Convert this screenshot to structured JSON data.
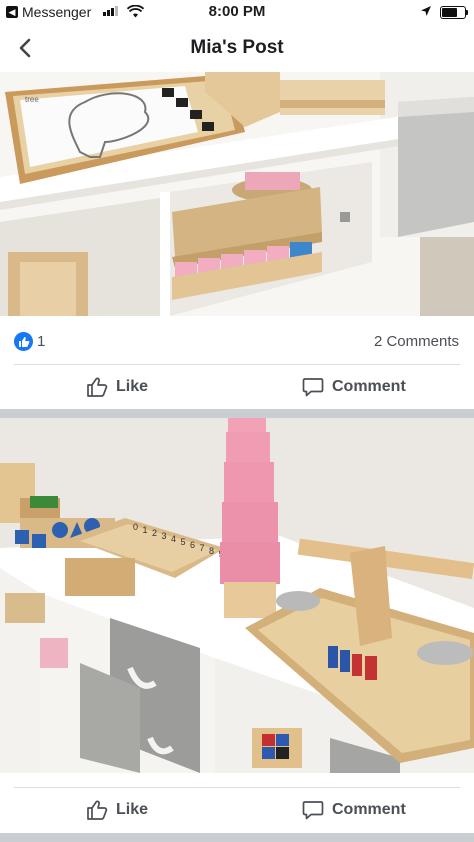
{
  "status_bar": {
    "back_app": "Messenger",
    "time": "8:00 PM",
    "battery_level": 0.75
  },
  "nav": {
    "title": "Mia's Post"
  },
  "post": {
    "reaction_count": "1",
    "comments_label": "2 Comments",
    "like_label": "Like",
    "comment_label": "Comment"
  },
  "photo1": {
    "card_label": "tree"
  },
  "photo2": {
    "numbers": [
      "0",
      "1",
      "2",
      "3",
      "4",
      "5",
      "6",
      "7",
      "8",
      "9"
    ]
  },
  "second_post": {
    "like_label": "Like",
    "comment_label": "Comment"
  },
  "colors": {
    "facebook_blue": "#1877f2",
    "text_gray": "#4b4f56",
    "separator": "#cacdd1"
  }
}
